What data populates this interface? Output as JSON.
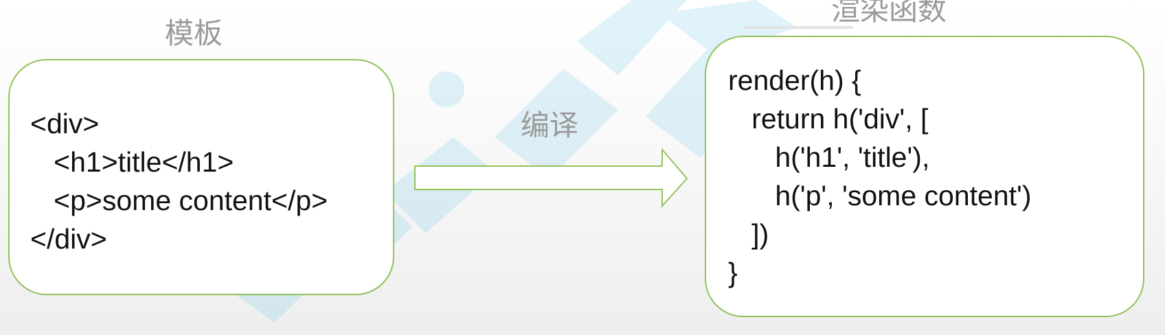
{
  "labels": {
    "template": "模板",
    "compile": "编译",
    "render_function": "渲染函数"
  },
  "template_code": [
    "<div>",
    "   <h1>title</h1>",
    "   <p>some content</p>",
    "</div>"
  ],
  "render_code": [
    "render(h) {",
    "   return h('div', [",
    "      h('h1', 'title'),",
    "      h('p', 'some content')",
    "   ])",
    "}"
  ],
  "colors": {
    "border": "#92c25a",
    "label_text": "#9a9a9a",
    "code_text": "#111111",
    "watermark": "#48b5e6"
  }
}
